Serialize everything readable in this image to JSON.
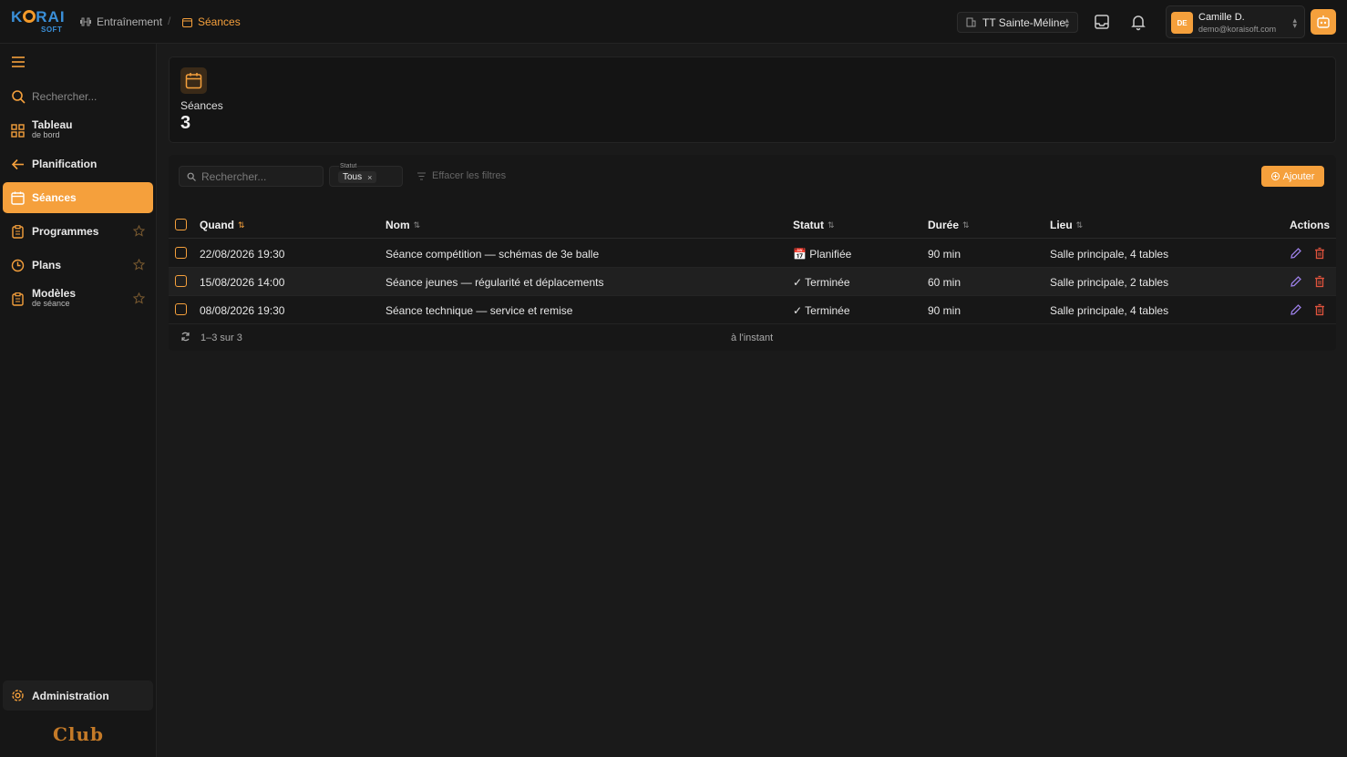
{
  "brand": {
    "logo_top": "KORAI",
    "logo_bottom": "SOFT"
  },
  "breadcrumb": {
    "parent": "Entraînement",
    "current": "Séances"
  },
  "club_selector": {
    "value": "TT Sainte-Méline"
  },
  "user": {
    "initials": "DE",
    "name": "Camille D.",
    "email": "demo@koraisoft.com"
  },
  "sidebar": {
    "search_placeholder": "Rechercher...",
    "items": [
      {
        "label": "Tableau",
        "sublabel": "de bord",
        "icon": "grid-icon"
      },
      {
        "label": "Planification",
        "icon": "arrow-left-icon"
      },
      {
        "label": "Séances",
        "icon": "calendar-icon",
        "active": true
      },
      {
        "label": "Programmes",
        "icon": "clipboard-icon"
      },
      {
        "label": "Plans",
        "icon": "clock-icon"
      },
      {
        "label": "Modèles",
        "sublabel": "de séance",
        "icon": "clipboard-icon"
      }
    ],
    "admin_label": "Administration",
    "footer_label": "Club"
  },
  "stat": {
    "label": "Séances",
    "value": "3"
  },
  "filters": {
    "search_placeholder": "Rechercher...",
    "status_label": "Statut",
    "status_value": "Tous",
    "clear_label": "Effacer les filtres",
    "add_label": "Ajouter"
  },
  "table": {
    "headers": {
      "when": "Quand",
      "name": "Nom",
      "status": "Statut",
      "duration": "Durée",
      "place": "Lieu",
      "actions": "Actions"
    },
    "rows": [
      {
        "when": "22/08/2026 19:30",
        "name": "Séance compétition — schémas de 3e balle",
        "status": "📅 Planifiée",
        "duration": "90 min",
        "place": "Salle principale, 4 tables"
      },
      {
        "when": "15/08/2026 14:00",
        "name": "Séance jeunes — régularité et déplacements",
        "status": "✓ Terminée",
        "duration": "60 min",
        "place": "Salle principale, 2 tables"
      },
      {
        "when": "08/08/2026 19:30",
        "name": "Séance technique — service et remise",
        "status": "✓ Terminée",
        "duration": "90 min",
        "place": "Salle principale, 4 tables"
      }
    ],
    "footer_count": "1–3 sur 3",
    "footer_updated": "à l'instant"
  },
  "colors": {
    "accent": "#f5a03c",
    "edit": "#9b7fe6",
    "delete": "#e0533d"
  }
}
